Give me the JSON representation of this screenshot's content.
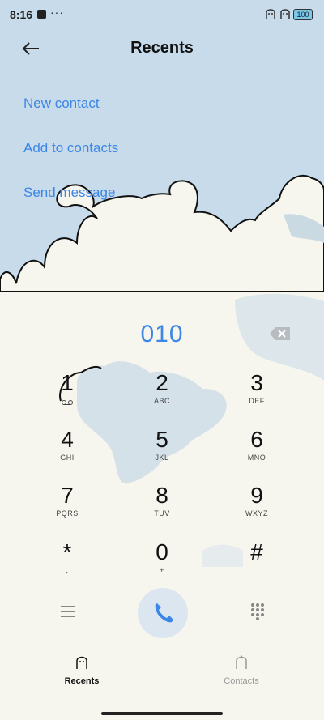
{
  "status": {
    "time": "8:16",
    "dots": "···",
    "battery": "100"
  },
  "header": {
    "title": "Recents"
  },
  "menu": [
    {
      "label": "New contact"
    },
    {
      "label": "Add to contacts"
    },
    {
      "label": "Send message"
    }
  ],
  "dialer": {
    "number": "010",
    "keys": [
      {
        "digit": "1",
        "letters": ""
      },
      {
        "digit": "2",
        "letters": "ABC"
      },
      {
        "digit": "3",
        "letters": "DEF"
      },
      {
        "digit": "4",
        "letters": "GHI"
      },
      {
        "digit": "5",
        "letters": "JKL"
      },
      {
        "digit": "6",
        "letters": "MNO"
      },
      {
        "digit": "7",
        "letters": "PQRS"
      },
      {
        "digit": "8",
        "letters": "TUV"
      },
      {
        "digit": "9",
        "letters": "WXYZ"
      },
      {
        "digit": "*",
        "letters": ","
      },
      {
        "digit": "0",
        "letters": "+"
      },
      {
        "digit": "#",
        "letters": ""
      }
    ]
  },
  "tabs": [
    {
      "label": "Recents",
      "active": true
    },
    {
      "label": "Contacts",
      "active": false
    }
  ],
  "colors": {
    "accent": "#3b86e6",
    "sky": "#c7dbea",
    "cream": "#f7f6ee"
  }
}
